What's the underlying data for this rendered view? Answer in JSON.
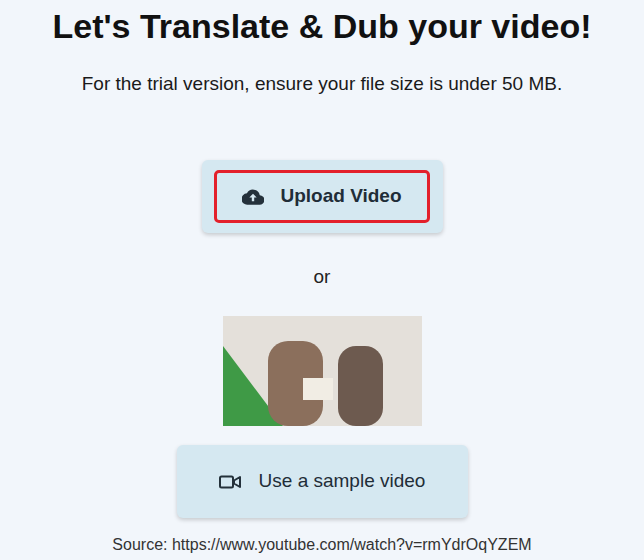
{
  "page": {
    "title": "Let's Translate & Dub your video!",
    "subtitle": "For the trial version, ensure your file size is under 50 MB."
  },
  "upload_button": {
    "label": "Upload Video",
    "highlighted": true
  },
  "separator": "or",
  "sample_button": {
    "label": "Use a sample video"
  },
  "source": "Source: https://www.youtube.com/watch?v=rmYdrOqYZEM"
}
